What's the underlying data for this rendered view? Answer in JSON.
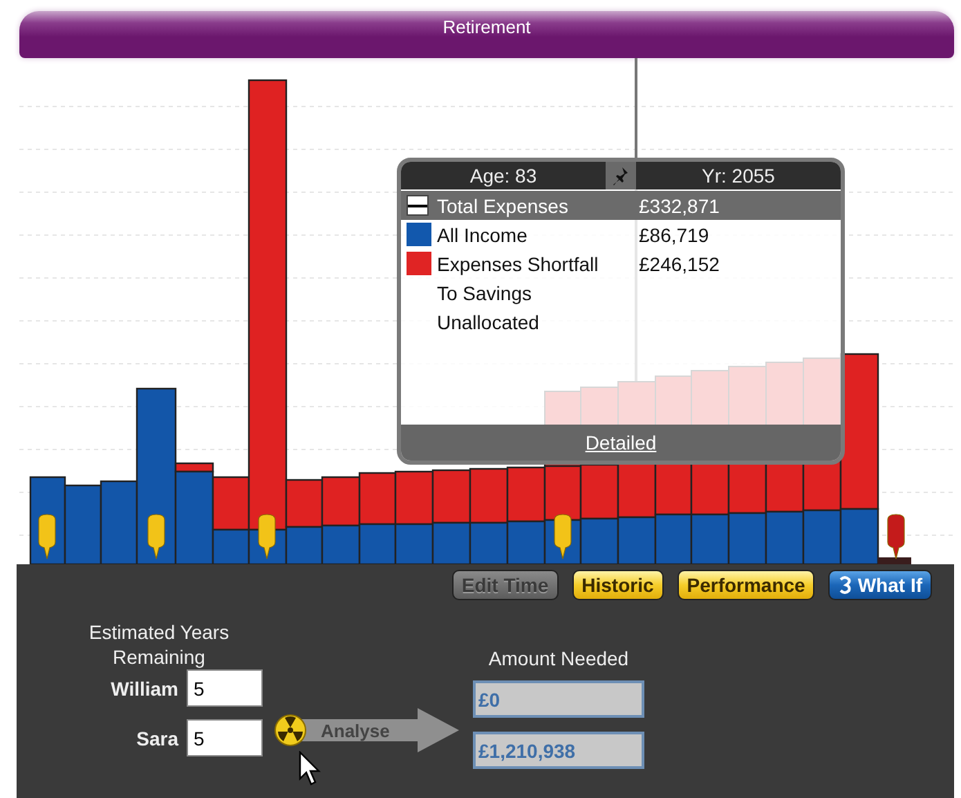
{
  "banner": {
    "title": "Retirement"
  },
  "tooltip": {
    "age": "Age: 83",
    "year": "Yr: 2055",
    "rows": [
      {
        "kind": "line",
        "label": "Total Expenses",
        "value": "£332,871",
        "selected": true
      },
      {
        "kind": "swatch",
        "label": "All Income",
        "value": "£86,719",
        "color": "#1258ad",
        "selected": false
      },
      {
        "kind": "swatch",
        "label": "Expenses Shortfall",
        "value": "£246,152",
        "color": "#e02424",
        "selected": false
      },
      {
        "kind": "plain",
        "label": "To Savings",
        "selected": false
      },
      {
        "kind": "plain",
        "label": "Unallocated",
        "selected": false
      }
    ],
    "link": "Detailed"
  },
  "toolbar": [
    {
      "kind": "standard",
      "label": "Edit Time",
      "disabled": true
    },
    {
      "kind": "standard",
      "label": "Historic",
      "disabled": false
    },
    {
      "kind": "standard",
      "label": "Performance",
      "disabled": false
    },
    {
      "kind": "whatif",
      "label": "What If",
      "disabled": false
    }
  ],
  "estimate": {
    "heading": "Estimated Years Remaining",
    "people": [
      {
        "name": "William",
        "value": "5"
      },
      {
        "name": "Sara",
        "value": "5"
      }
    ]
  },
  "analyse": {
    "label": "Analyse"
  },
  "result": {
    "heading": "Amount Needed",
    "values": [
      "£0",
      "£1,210,938"
    ]
  }
}
